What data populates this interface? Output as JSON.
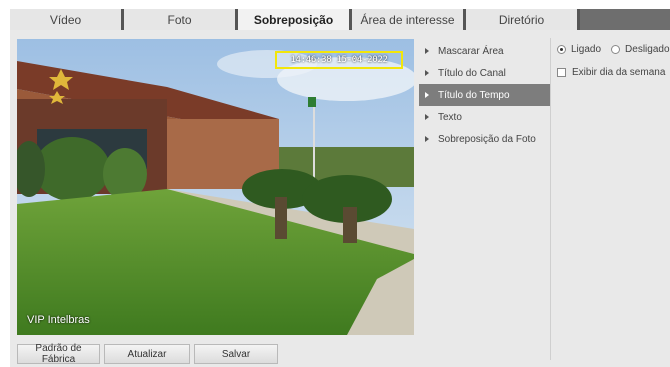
{
  "tabs": [
    {
      "label": "Vídeo",
      "active": false
    },
    {
      "label": "Foto",
      "active": false
    },
    {
      "label": "Sobreposição",
      "active": true
    },
    {
      "label": "Área de interesse",
      "active": false
    },
    {
      "label": "Diretório",
      "active": false
    }
  ],
  "preview": {
    "time_osd": "14:46:38 15-04-2022",
    "channel_osd": "VIP Intelbras"
  },
  "menu": {
    "items": [
      {
        "label": "Mascarar Área",
        "active": false
      },
      {
        "label": "Título do Canal",
        "active": false
      },
      {
        "label": "Título do Tempo",
        "active": true
      },
      {
        "label": "Texto",
        "active": false
      },
      {
        "label": "Sobreposição da Foto",
        "active": false
      }
    ]
  },
  "options": {
    "on_label": "Ligado",
    "off_label": "Desligado",
    "selected": "Ligado",
    "show_weekday_label": "Exibir dia da semana",
    "show_weekday_checked": false
  },
  "buttons": {
    "factory_default": "Padrão de Fábrica",
    "refresh": "Atualizar",
    "save": "Salvar"
  },
  "colors": {
    "tab_strip": "#6e6e6e",
    "menu_active": "#7d7d7d",
    "panel_bg": "#e9e9e9",
    "osd_box": "#f2e60a"
  }
}
